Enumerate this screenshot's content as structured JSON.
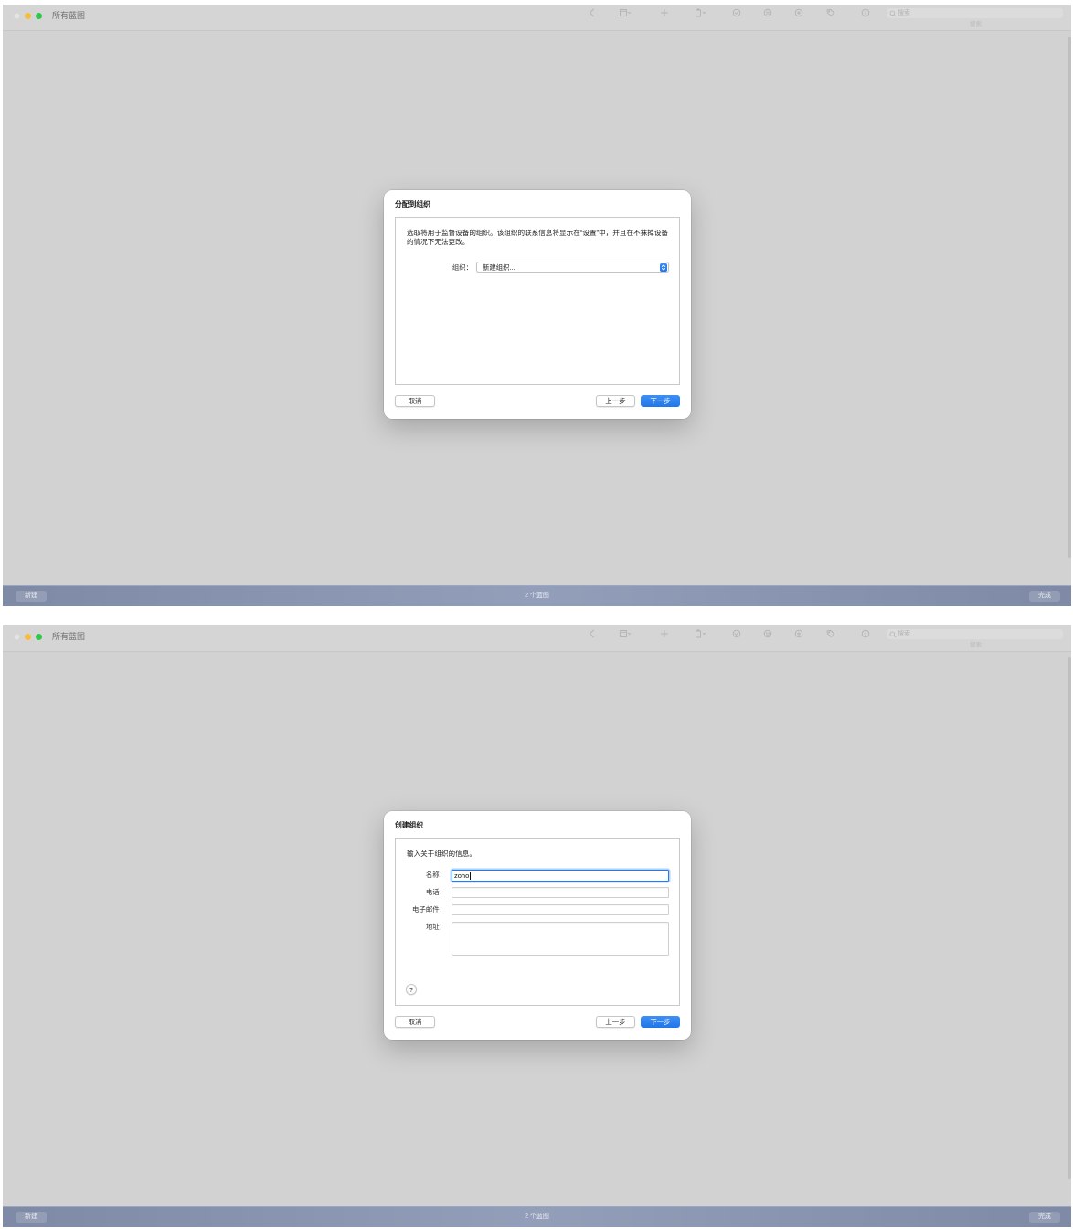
{
  "window": {
    "title": "所有蓝图",
    "toolbar": {
      "icons": [
        "chevron-left-icon",
        "view-mode-icon",
        "add-icon",
        "device-icon",
        "prepare-icon",
        "pause-icon",
        "restore-icon",
        "tag-icon",
        "info-icon"
      ]
    },
    "search": {
      "placeholder": "搜索",
      "label": "搜索"
    },
    "bottom_bar": {
      "new_label": "新建",
      "count_label": "2 个蓝图",
      "done_label": "完成"
    }
  },
  "screens": [
    {
      "dialog": {
        "title": "分配到组织",
        "description": "选取将用于监督设备的组织。该组织的联系信息将显示在“设置”中，并且在不抹掉设备的情况下无法更改。",
        "organization": {
          "label": "组织：",
          "value": "新建组织..."
        },
        "buttons": {
          "cancel": "取消",
          "back": "上一步",
          "next": "下一步"
        }
      }
    },
    {
      "dialog": {
        "title": "创建组织",
        "description": "输入关于组织的信息。",
        "fields": {
          "name": {
            "label": "名称：",
            "value": "zoho"
          },
          "phone": {
            "label": "电话：",
            "value": ""
          },
          "email": {
            "label": "电子邮件：",
            "value": ""
          },
          "address": {
            "label": "地址：",
            "value": ""
          }
        },
        "help": "?",
        "buttons": {
          "cancel": "取消",
          "back": "上一步",
          "next": "下一步"
        }
      }
    }
  ],
  "colors": {
    "accent": "#1f7cf3",
    "scrim": "#d2d2d2",
    "bottom_bar": "#8794b2",
    "traffic_close": "#e4e4e4",
    "traffic_minimize": "#f5bd3b",
    "traffic_zoom": "#31c74b"
  }
}
